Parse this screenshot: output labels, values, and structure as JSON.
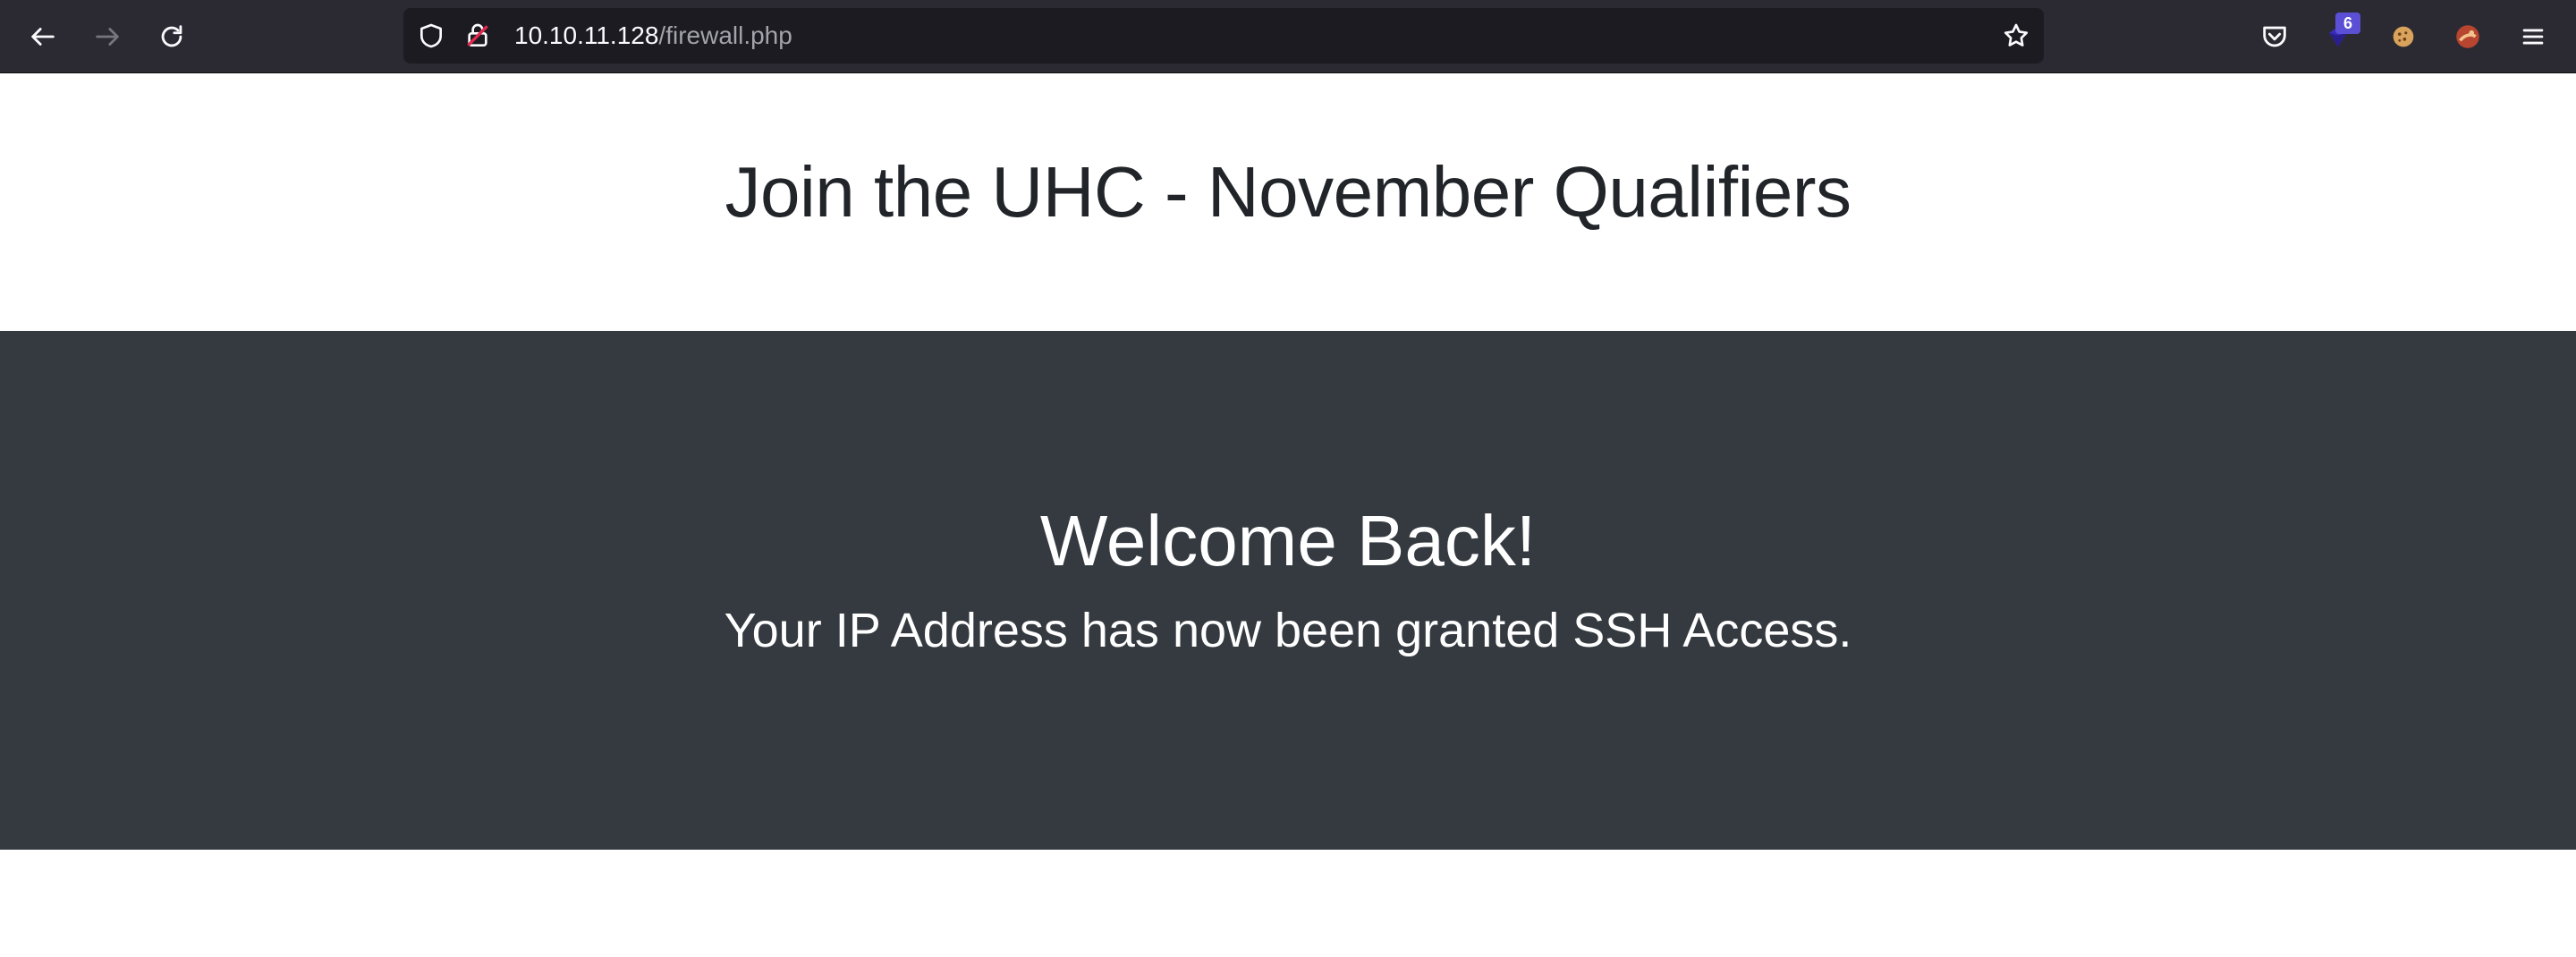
{
  "browser": {
    "url_host": "10.10.11.128",
    "url_path": "/firewall.php",
    "extension_badge": "6",
    "icons": {
      "back": "arrow-left-icon",
      "forward": "arrow-right-icon",
      "reload": "reload-icon",
      "tracking": "shield-icon",
      "insecure": "insecure-lock-icon",
      "bookmark": "star-icon",
      "pocket": "pocket-icon",
      "extension": "gem-extension-icon",
      "cookie": "cookie-icon",
      "avatar": "avatar-icon",
      "menu": "hamburger-menu-icon"
    }
  },
  "page": {
    "title": "Join the UHC - November Qualifiers",
    "hero_title": "Welcome Back!",
    "hero_message": "Your IP Address has now been granted SSH Access."
  },
  "colors": {
    "toolbar": "#2b2a33",
    "urlbar": "#1c1b22",
    "hero_background": "#343a40",
    "title_text": "#212529"
  }
}
